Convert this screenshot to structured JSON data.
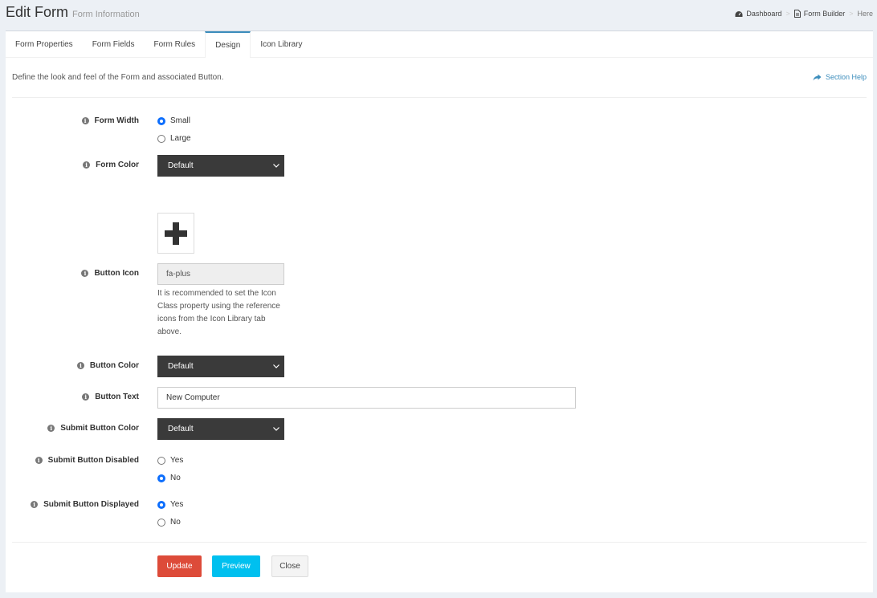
{
  "header": {
    "title": "Edit Form",
    "subtitle": "Form Information",
    "breadcrumb": [
      {
        "label": "Dashboard",
        "icon": "dashboard-icon"
      },
      {
        "label": "Form Builder",
        "icon": "file-icon"
      },
      {
        "label": "Here"
      }
    ]
  },
  "tabs": [
    {
      "label": "Form Properties",
      "active": false
    },
    {
      "label": "Form Fields",
      "active": false
    },
    {
      "label": "Form Rules",
      "active": false
    },
    {
      "label": "Design",
      "active": true
    },
    {
      "label": "Icon Library",
      "active": false
    }
  ],
  "section": {
    "description": "Define the look and feel of the Form and associated Button.",
    "help_label": "Section Help"
  },
  "form": {
    "form_width": {
      "label": "Form Width",
      "options": [
        "Small",
        "Large"
      ],
      "selected": "Small"
    },
    "form_color": {
      "label": "Form Color",
      "value": "Default"
    },
    "button_icon": {
      "label": "Button Icon",
      "value": "fa-plus",
      "help": "It is recommended to set the Icon Class property using the reference icons from the Icon Library tab above."
    },
    "button_color": {
      "label": "Button Color",
      "value": "Default"
    },
    "button_text": {
      "label": "Button Text",
      "value": "New Computer"
    },
    "submit_button_color": {
      "label": "Submit Button Color",
      "value": "Default"
    },
    "submit_button_disabled": {
      "label": "Submit Button Disabled",
      "options": [
        "Yes",
        "No"
      ],
      "selected": "No"
    },
    "submit_button_displayed": {
      "label": "Submit Button Displayed",
      "options": [
        "Yes",
        "No"
      ],
      "selected": "Yes"
    }
  },
  "actions": {
    "update": "Update",
    "preview": "Preview",
    "close": "Close"
  },
  "colors": {
    "update": "#dd4b39",
    "preview": "#00c0ef",
    "accent": "#3c8dbc",
    "select_bg": "#3a3a3a"
  }
}
